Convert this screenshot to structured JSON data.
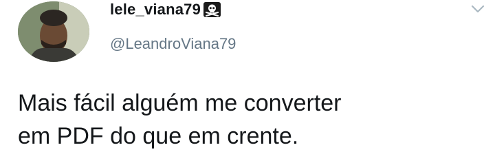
{
  "tweet": {
    "display_name": "lele_viana79",
    "name_emoji_icon": "skull-and-crossbones-icon",
    "handle": "@LeandroViana79",
    "caret_icon": "chevron-down-icon",
    "text_lines": [
      "Mais fácil alguém me converter",
      "em PDF do que em crente."
    ]
  },
  "colors": {
    "background": "#ffffff",
    "name": "#14171a",
    "handle": "#657786",
    "caret": "#aab8c2"
  }
}
